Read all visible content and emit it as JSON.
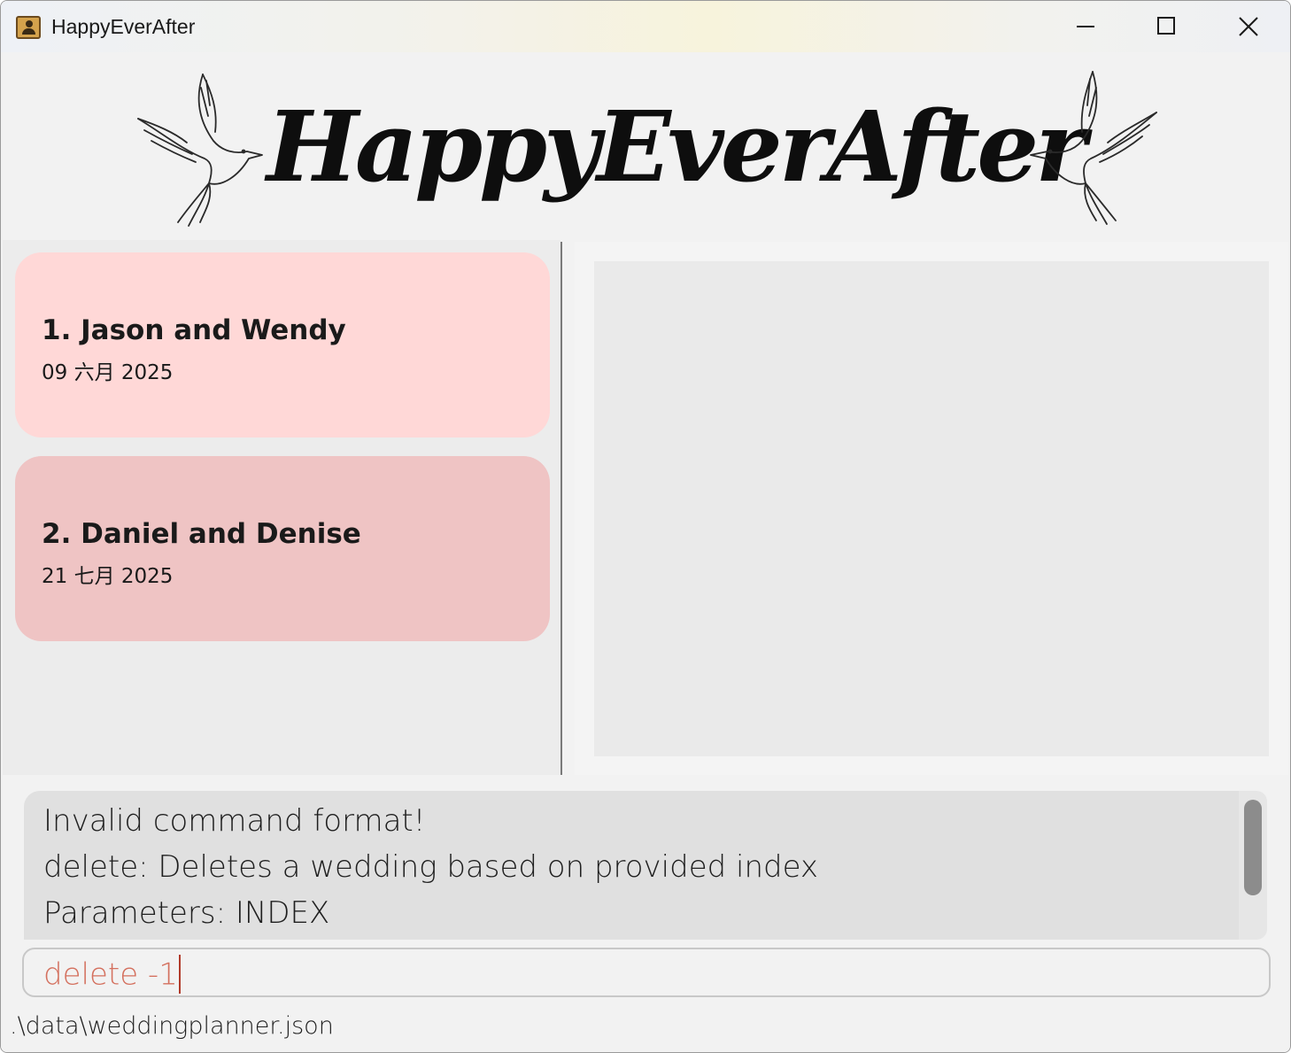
{
  "window": {
    "title": "HappyEverAfter"
  },
  "banner": {
    "logo_text": "HappyEverAfter"
  },
  "weddings": [
    {
      "name": "1. Jason and Wendy",
      "date": "09 六月 2025",
      "color": "#ffd8d7"
    },
    {
      "name": "2. Daniel and Denise",
      "date": "21 七月 2025",
      "color": "#efc4c4"
    }
  ],
  "result": {
    "lines": [
      "Invalid command format!",
      "delete: Deletes a wedding based on provided index",
      "Parameters: INDEX"
    ]
  },
  "command": {
    "value": "delete -1"
  },
  "status": {
    "file_path": ".\\data\\weddingplanner.json"
  },
  "icons": {
    "app": "address-book-icon",
    "minimize": "minimize-icon",
    "maximize": "maximize-icon",
    "close": "close-icon"
  }
}
